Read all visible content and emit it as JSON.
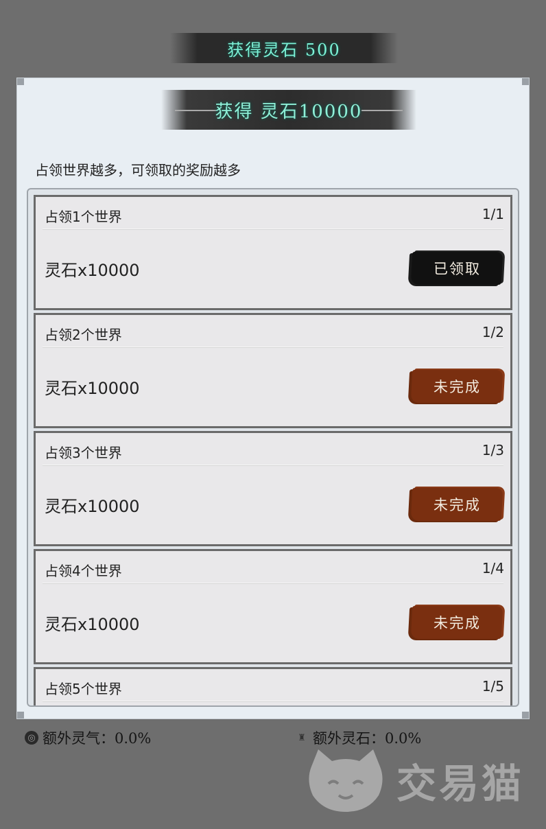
{
  "toast": {
    "text": "获得灵石 500"
  },
  "dialog": {
    "banner_text": "获得 灵石10000",
    "description": "占领世界越多，可领取的奖励越多",
    "items": [
      {
        "title": "占领1个世界",
        "progress": "1/1",
        "reward": "灵石x10000",
        "button": "已领取",
        "state": "claimed"
      },
      {
        "title": "占领2个世界",
        "progress": "1/2",
        "reward": "灵石x10000",
        "button": "未完成",
        "state": "incomplete"
      },
      {
        "title": "占领3个世界",
        "progress": "1/3",
        "reward": "灵石x10000",
        "button": "未完成",
        "state": "incomplete"
      },
      {
        "title": "占领4个世界",
        "progress": "1/4",
        "reward": "灵石x10000",
        "button": "未完成",
        "state": "incomplete"
      },
      {
        "title": "占领5个世界",
        "progress": "1/5",
        "reward": "",
        "button": "",
        "state": "partial"
      }
    ]
  },
  "stats": {
    "extra_qi": "额外灵气：0.0%",
    "extra_stone": "额外灵石：0.0%"
  },
  "watermark": {
    "text": "交易猫"
  },
  "colors": {
    "claimed_button": "#111111",
    "incomplete_button": "#7a2f10",
    "banner_text": "#8ff0d8"
  }
}
